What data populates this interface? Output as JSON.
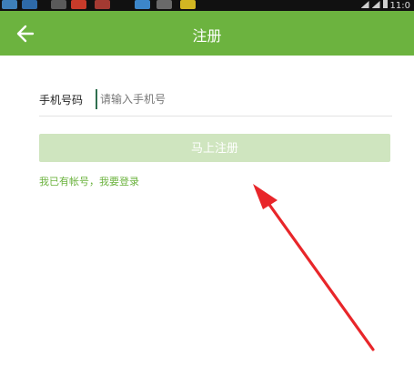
{
  "app_bar": {
    "title": "注册",
    "back_icon": "arrow-left-icon",
    "color": "#6cb33f"
  },
  "status_bar": {
    "time": "11:0"
  },
  "form": {
    "phone_label": "手机号码",
    "phone_placeholder": "请输入手机号",
    "phone_value": ""
  },
  "actions": {
    "register_label": "马上注册",
    "login_link": "我已有帐号，我要登录"
  },
  "colors": {
    "accent": "#6cb33f",
    "button_disabled": "#cfe5bf",
    "annotation_arrow": "#e8262a"
  }
}
